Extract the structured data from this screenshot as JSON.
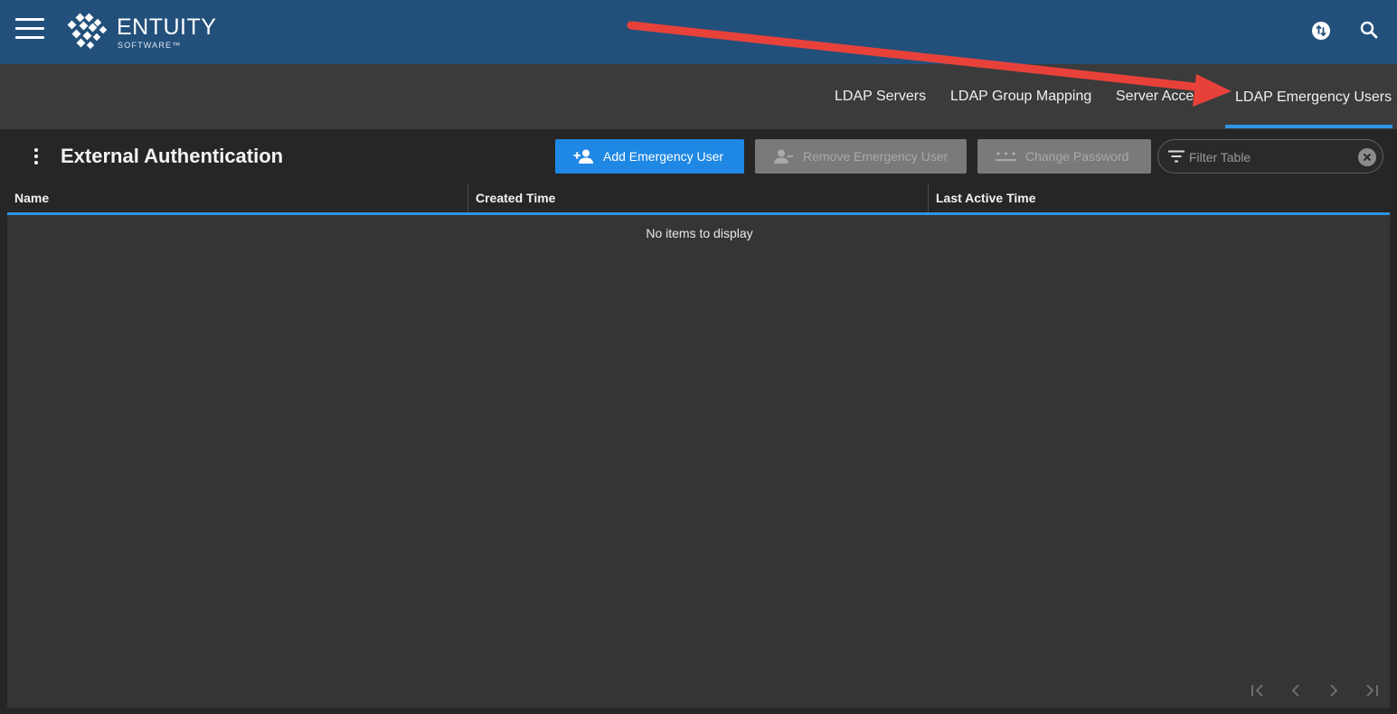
{
  "brand": {
    "name": "ENTUITY",
    "tagline": "SOFTWARE™"
  },
  "tabs": [
    {
      "label": "LDAP Servers",
      "active": false
    },
    {
      "label": "LDAP Group Mapping",
      "active": false
    },
    {
      "label": "Server Access",
      "active": false
    },
    {
      "label": "LDAP Emergency Users",
      "active": true
    }
  ],
  "panel": {
    "title": "External Authentication",
    "buttons": {
      "add": "Add Emergency User",
      "remove": "Remove Emergency User",
      "change_password": "Change Password"
    },
    "filter": {
      "placeholder": "Filter Table",
      "value": ""
    }
  },
  "table": {
    "columns": [
      "Name",
      "Created Time",
      "Last Active Time"
    ],
    "rows": [],
    "empty_message": "No items to display"
  },
  "colors": {
    "header_bg": "#23507b",
    "accent": "#2c95e8",
    "primary_button": "#1f88e5",
    "disabled_button": "#7a7a7a",
    "annotation_arrow": "#e8413a"
  },
  "icons": {
    "menu": "hamburger-icon",
    "sync": "sync-icon",
    "search": "search-icon",
    "panel_menu": "kebab-icon",
    "add": "person-add-icon",
    "remove": "person-remove-icon",
    "password": "password-icon",
    "filter": "filter-icon",
    "clear": "clear-icon",
    "pager": [
      "first-page-icon",
      "prev-page-icon",
      "next-page-icon",
      "last-page-icon"
    ]
  }
}
